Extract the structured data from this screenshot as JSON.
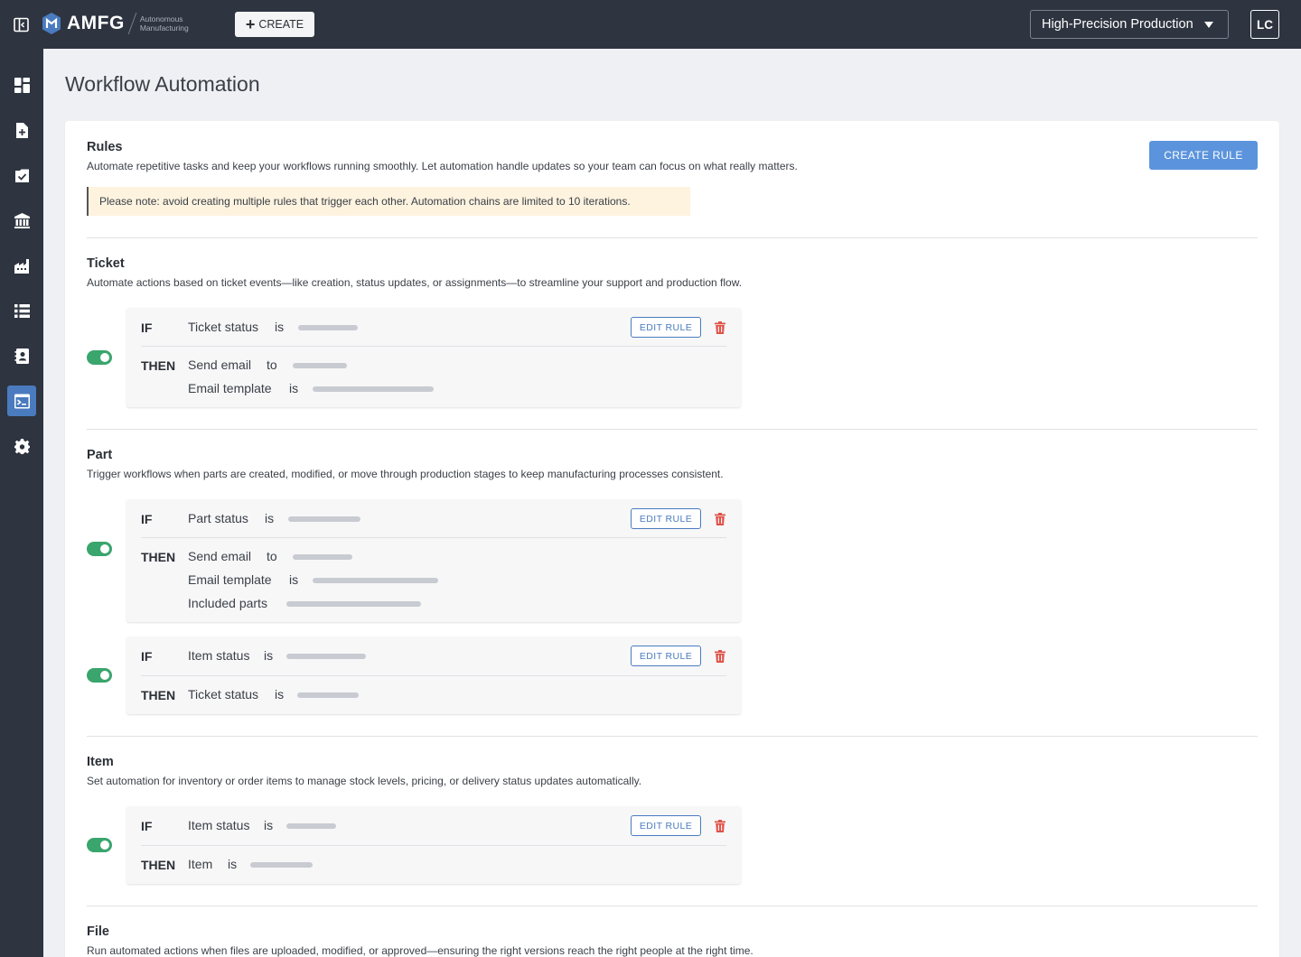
{
  "header": {
    "logo_text": "AMFG",
    "logo_sub_line1": "Autonomous",
    "logo_sub_line2": "Manufacturing",
    "create_label": "CREATE",
    "workspace": "High-Precision Production",
    "avatar_initials": "LC"
  },
  "sidebar": {
    "items": [
      {
        "icon": "dashboard-icon"
      },
      {
        "icon": "add-document-icon"
      },
      {
        "icon": "checklist-icon"
      },
      {
        "icon": "building-icon"
      },
      {
        "icon": "factory-icon"
      },
      {
        "icon": "list-icon"
      },
      {
        "icon": "contacts-icon"
      },
      {
        "icon": "terminal-icon",
        "active": true
      },
      {
        "icon": "gear-icon"
      }
    ]
  },
  "page": {
    "title": "Workflow Automation"
  },
  "rules": {
    "title": "Rules",
    "description": "Automate repetitive tasks and keep your workflows running smoothly. Let automation handle updates so your team can focus on what really matters.",
    "note": "Please note: avoid creating multiple rules that trigger each other. Automation chains are limited to 10 iterations.",
    "create_rule_label": "CREATE RULE"
  },
  "labels": {
    "if": "IF",
    "then": "THEN",
    "edit_rule": "EDIT RULE"
  },
  "sections": {
    "ticket": {
      "title": "Ticket",
      "description": "Automate actions based on ticket events—like creation, status updates, or assignments—to streamline your support and production flow.",
      "rule1": {
        "enabled": true,
        "if_field": "Ticket status",
        "if_op": "is",
        "then1_field": "Send email",
        "then1_op": "to",
        "then2_field": "Email template",
        "then2_op": "is"
      }
    },
    "part": {
      "title": "Part",
      "description": "Trigger workflows when parts are created, modified, or move through production stages to keep manufacturing processes consistent.",
      "rule1": {
        "enabled": true,
        "if_field": "Part status",
        "if_op": "is",
        "then1_field": "Send email",
        "then1_op": "to",
        "then2_field": "Email template",
        "then2_op": "is",
        "then3_field": "Included parts"
      },
      "rule2": {
        "enabled": true,
        "if_field": "Item status",
        "if_op": "is",
        "then1_field": "Ticket status",
        "then1_op": "is"
      }
    },
    "item": {
      "title": "Item",
      "description": "Set automation for inventory or order items to manage stock levels, pricing, or delivery status updates automatically.",
      "rule1": {
        "enabled": true,
        "if_field": "Item status",
        "if_op": "is",
        "then1_field": "Item",
        "then1_op": "is"
      }
    },
    "file": {
      "title": "File",
      "description": "Run automated actions when files are uploaded, modified, or approved—ensuring the right versions reach the right people at the right time."
    }
  },
  "colors": {
    "topbar": "#2e3440",
    "accent": "#5b94dc",
    "toggle_on": "#3aa56d",
    "delete": "#e0534a",
    "note_bg": "#fdf3df"
  }
}
